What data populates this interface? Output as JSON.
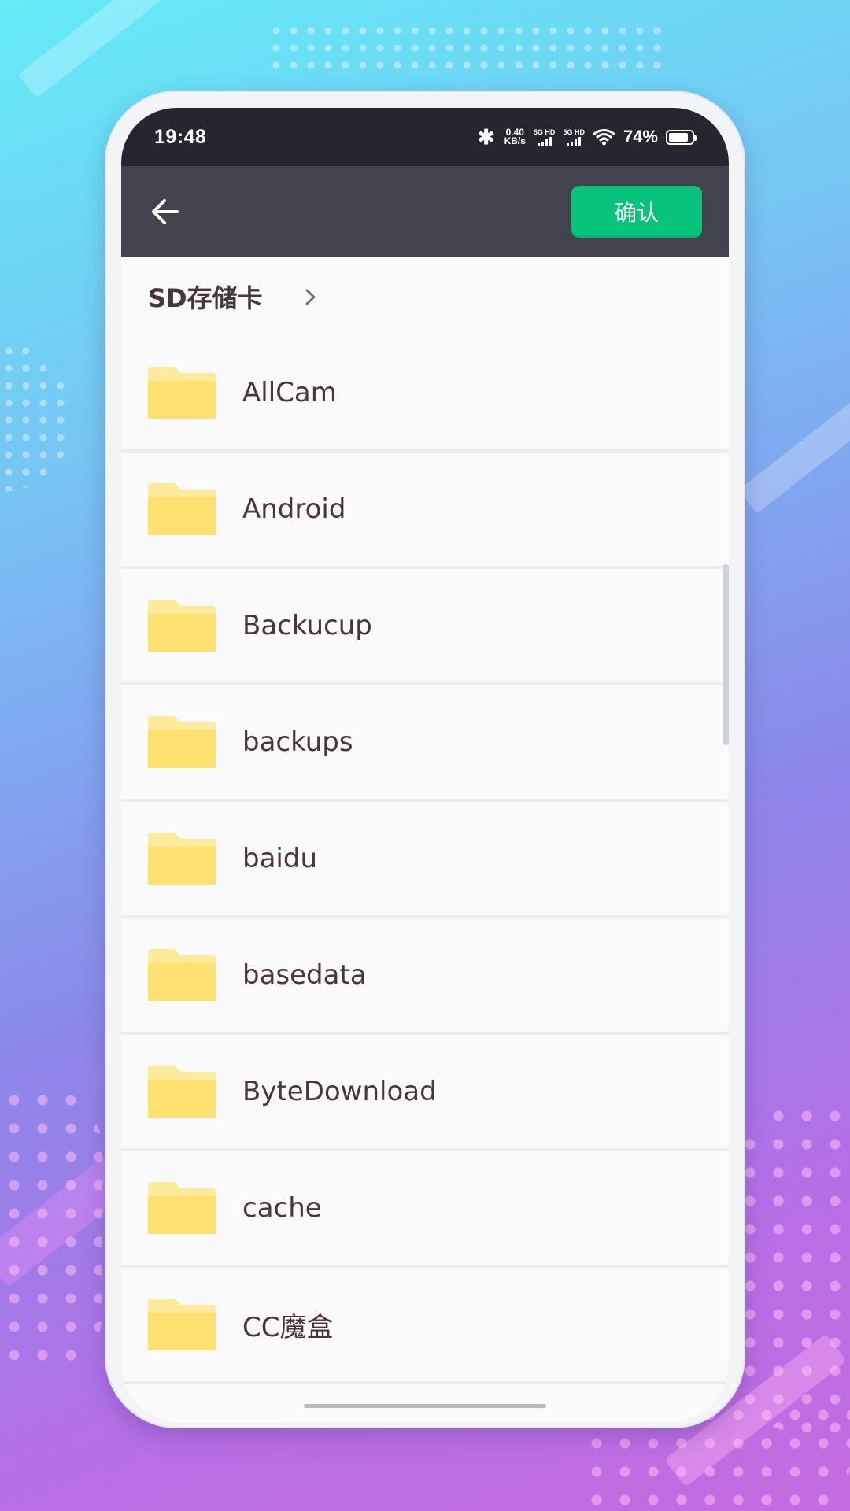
{
  "status_bar": {
    "time": "19:48",
    "bluetooth": "✱",
    "network_speed_value": "0.40",
    "network_speed_unit": "KB/s",
    "signal_1_label": "5G HD",
    "signal_2_label": "5G HD",
    "battery_text": "74%",
    "battery_level": 0.74,
    "icons": [
      "bluetooth-icon",
      "signal-icon",
      "wifi-icon",
      "battery-icon"
    ]
  },
  "app_bar": {
    "back_icon": "arrow-left-icon",
    "confirm_label": "确认",
    "background": "#434350",
    "confirm_color": "#08c47b"
  },
  "breadcrumb": {
    "path": "SD存储卡",
    "separator_icon": "chevron-right-icon"
  },
  "folders": [
    {
      "name": "AllCam",
      "icon": "folder-icon"
    },
    {
      "name": "Android",
      "icon": "folder-icon"
    },
    {
      "name": "Backucup",
      "icon": "folder-icon"
    },
    {
      "name": "backups",
      "icon": "folder-icon"
    },
    {
      "name": "baidu",
      "icon": "folder-icon"
    },
    {
      "name": "basedata",
      "icon": "folder-icon"
    },
    {
      "name": "ByteDownload",
      "icon": "folder-icon"
    },
    {
      "name": "cache",
      "icon": "folder-icon"
    },
    {
      "name": "CC魔盒",
      "icon": "folder-icon"
    }
  ],
  "colors": {
    "folder": "#fde06f",
    "folder_tab": "#fdeb9b",
    "text": "#4a3636",
    "status_bar": "#26262f"
  }
}
